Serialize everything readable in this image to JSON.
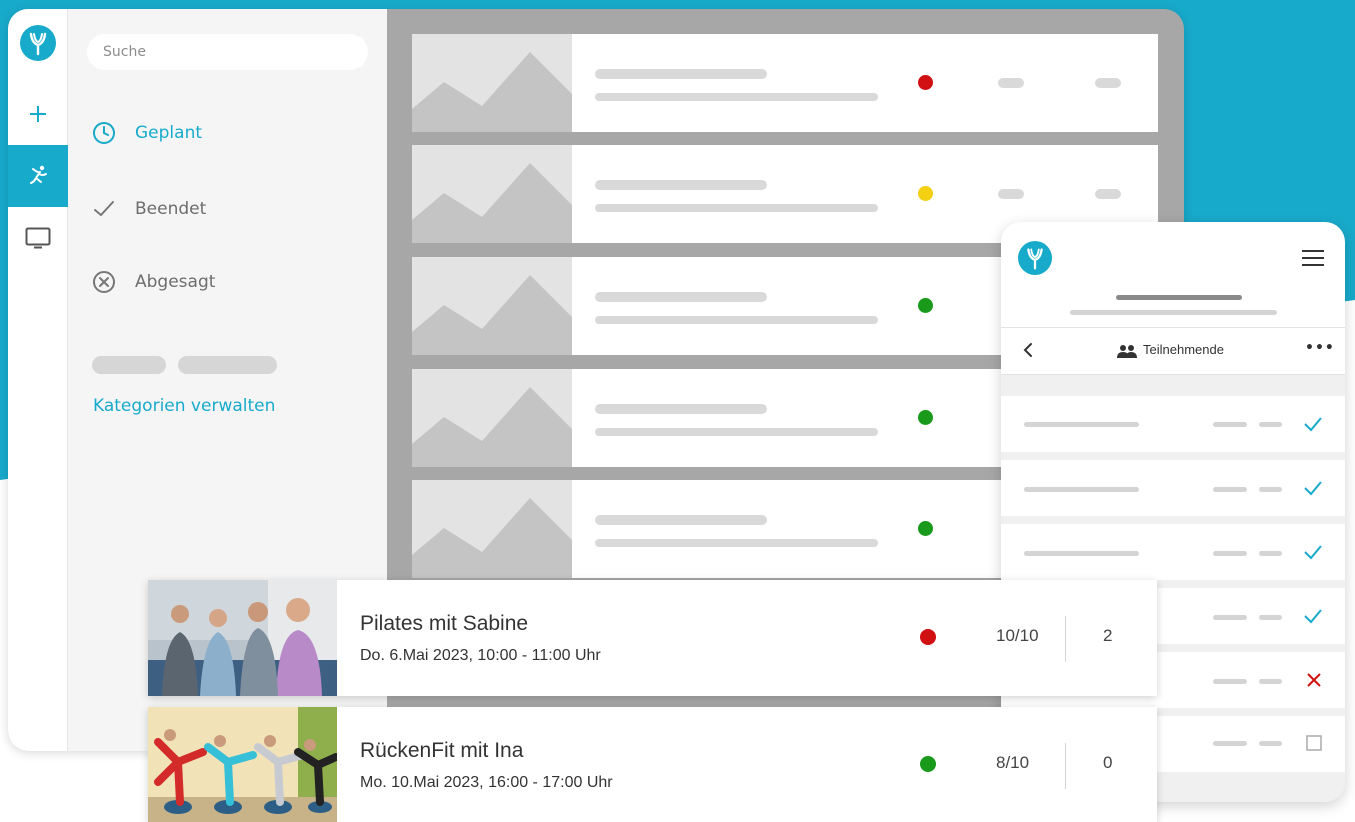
{
  "colors": {
    "accent": "#18aacb",
    "red": "#d01012",
    "yellow": "#f4d012",
    "green": "#1a9a1a"
  },
  "sidebar": {
    "search_placeholder": "Suche",
    "items": [
      {
        "label": "Geplant",
        "icon": "clock-icon",
        "active": true
      },
      {
        "label": "Beendet",
        "icon": "check-icon",
        "active": false
      },
      {
        "label": "Abgesagt",
        "icon": "cancel-circle-icon",
        "active": false
      }
    ],
    "manage_link": "Kategorien verwalten"
  },
  "rail": [
    "logo-icon",
    "plus-icon",
    "activity-icon",
    "monitor-icon"
  ],
  "placeholder_rows": [
    {
      "status": "red"
    },
    {
      "status": "yellow"
    },
    {
      "status": "green"
    },
    {
      "status": "green"
    },
    {
      "status": "green"
    }
  ],
  "mobile": {
    "toolbar_title": "Teilnehmende",
    "back_icon": "chevron-left-icon",
    "more_icon": "more-icon",
    "rows": [
      {
        "mark": "check"
      },
      {
        "mark": "check"
      },
      {
        "mark": "check"
      },
      {
        "mark": "check"
      },
      {
        "mark": "cross"
      },
      {
        "mark": "empty"
      }
    ]
  },
  "cards": [
    {
      "title": "Pilates mit Sabine",
      "date": "Do. 6.Mai 2023, 10:00 - 11:00 Uhr",
      "status": "red",
      "count": "10/10",
      "number": "2"
    },
    {
      "title": "RückenFit mit Ina",
      "date": "Mo. 10.Mai 2023, 16:00 - 17:00 Uhr",
      "status": "green",
      "count": "8/10",
      "number": "0"
    }
  ]
}
